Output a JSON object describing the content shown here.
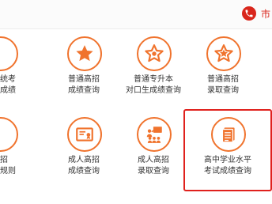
{
  "header": {
    "phone_icon": "phone-icon",
    "phone_text": "市"
  },
  "colors": {
    "accent": "#f0732d",
    "highlight_border": "#e0211d",
    "phone": "#d9261c"
  },
  "grid": {
    "row1": [
      {
        "line1": "统考",
        "line2": "成绩",
        "icon": "partial-icon"
      },
      {
        "line1": "普通高招",
        "line2": "成绩查询",
        "icon": "star-filled-icon"
      },
      {
        "line1": "普通专升本",
        "line2": "对口生成绩查询",
        "icon": "star-outline-icon"
      },
      {
        "line1": "普通高招",
        "line2": "录取查询",
        "icon": "star-outline-icon"
      }
    ],
    "row2": [
      {
        "line1": "招",
        "line2": "规则",
        "icon": "partial-icon"
      },
      {
        "line1": "成人高招",
        "line2": "成绩查询",
        "icon": "certificate-icon"
      },
      {
        "line1": "成人高招",
        "line2": "录取查询",
        "icon": "people-board-icon"
      },
      {
        "line1": "高中学业水平",
        "line2": "考试成绩查询",
        "icon": "document-list-icon"
      }
    ]
  }
}
